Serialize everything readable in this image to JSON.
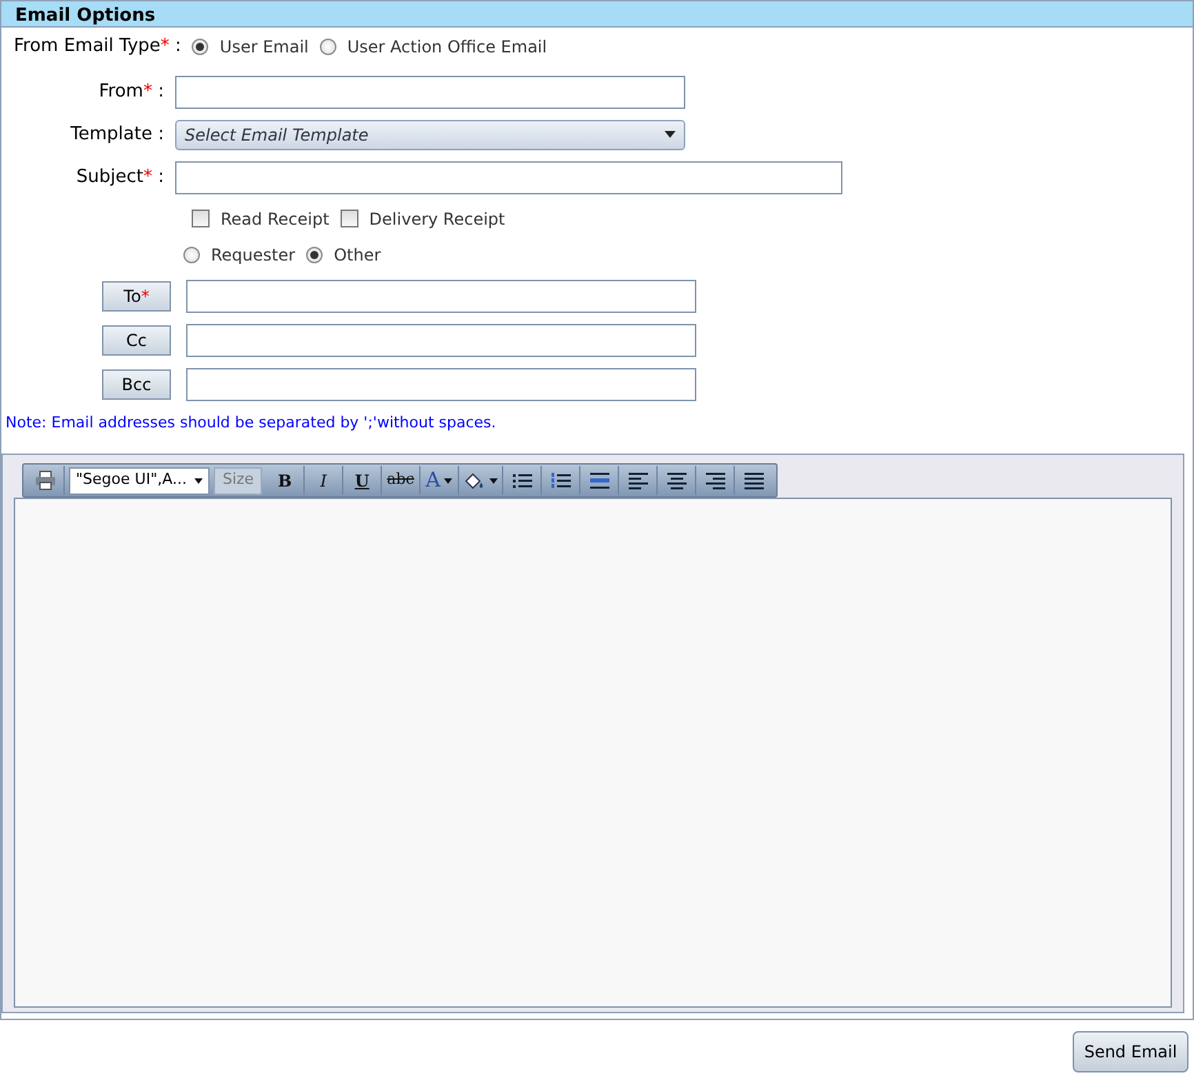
{
  "section_title": "Email Options",
  "from_email_type": {
    "label": "From Email Type",
    "required_mark": "*",
    "suffix": " :",
    "options": [
      {
        "label": "User Email",
        "selected": true
      },
      {
        "label": "User Action Office Email",
        "selected": false
      }
    ]
  },
  "fields": [
    {
      "kind": "text",
      "label": "From",
      "required_mark": "*",
      "suffix": " :"
    },
    {
      "kind": "select",
      "label": "Template",
      "suffix": " :",
      "placeholder": "Select Email Template"
    },
    {
      "kind": "text",
      "label": "Subject",
      "required_mark": "*",
      "suffix": " :"
    }
  ],
  "receipts": [
    {
      "label": "Read Receipt",
      "checked": false
    },
    {
      "label": "Delivery Receipt",
      "checked": false
    }
  ],
  "recipient_type": [
    {
      "label": "Requester",
      "selected": false
    },
    {
      "label": "Other",
      "selected": true
    }
  ],
  "address_fields": [
    {
      "label": "To",
      "required_mark": "*"
    },
    {
      "label": "Cc"
    },
    {
      "label": "Bcc"
    }
  ],
  "note": "Note: Email addresses should be separated by ';'without spaces.",
  "toolbar": [
    {
      "kind": "icon"
    },
    {
      "kind": "dropdown",
      "text": "\"Segoe UI\",A..."
    },
    {
      "kind": "size",
      "text": "Size"
    },
    {
      "kind": "glyph",
      "text": "B"
    },
    {
      "kind": "glyph",
      "text": "I"
    },
    {
      "kind": "glyph",
      "text": "U"
    },
    {
      "kind": "glyph",
      "text": "abc"
    },
    {
      "kind": "glyph",
      "text": "A"
    },
    {
      "kind": "icon"
    },
    {
      "kind": "icon"
    },
    {
      "kind": "icon"
    },
    {
      "kind": "icon"
    },
    {
      "kind": "icon"
    },
    {
      "kind": "icon"
    },
    {
      "kind": "icon"
    },
    {
      "kind": "icon"
    }
  ],
  "send_button": "Send Email"
}
